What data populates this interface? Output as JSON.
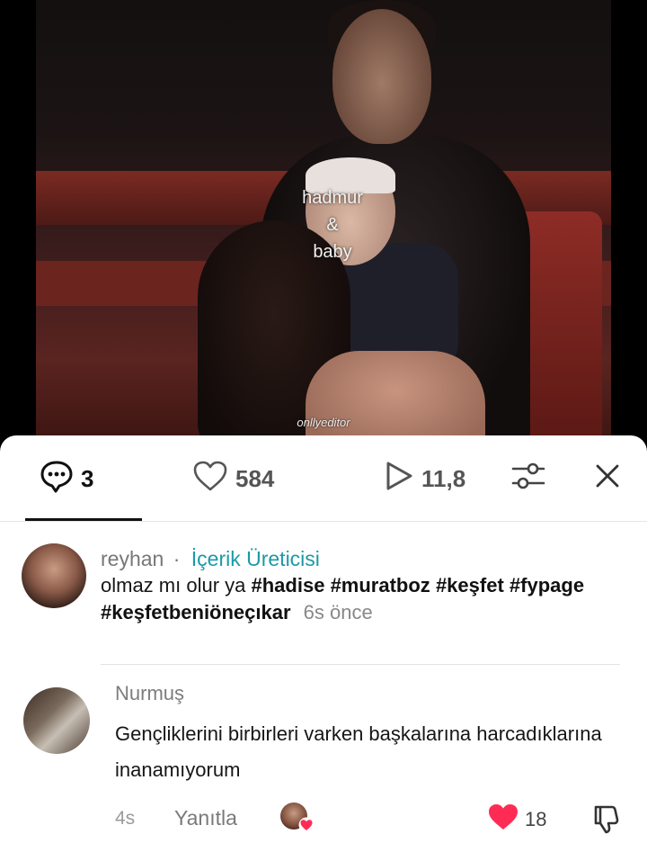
{
  "video": {
    "overlay_lines": [
      "hadmur",
      "&",
      "baby"
    ],
    "watermark": "onllyeditor"
  },
  "tabs": {
    "comments_count": "3",
    "likes_count": "584",
    "views_count": "11,8",
    "comments_icon": "comment-bubble-icon",
    "likes_icon": "heart-outline-icon",
    "views_icon": "play-icon",
    "filter_icon": "sliders-icon",
    "close_icon": "close-icon"
  },
  "post": {
    "author": "reyhan",
    "separator": "·",
    "role": "İçerik Üreticisi",
    "text": "olmaz mı olur ya ",
    "hashtags": [
      "#hadise",
      "#muratboz",
      "#keşfet",
      "#fypage",
      "#keşfetbeniöneçıkar"
    ],
    "time": "6s önce"
  },
  "comment": {
    "author": "Nurmuş",
    "text": "Gençliklerini birbirleri varken başkalarına harcadıklarına inanamıyorum",
    "time": "4s",
    "reply_label": "Yanıtla",
    "like_count": "18",
    "liked": true
  },
  "colors": {
    "role": "#1a9aa8",
    "like": "#fe2c55"
  }
}
